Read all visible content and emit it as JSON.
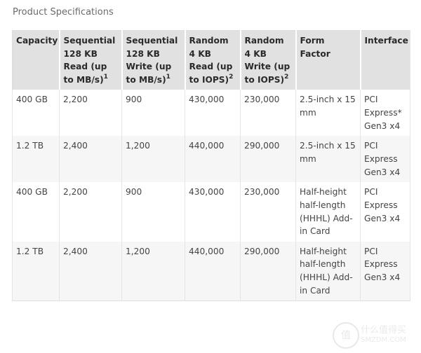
{
  "page": {
    "title": "Product Specifications"
  },
  "table": {
    "headers": [
      {
        "label": "Capacity",
        "sup": ""
      },
      {
        "label": "Sequential 128 KB Read (up to MB/s)",
        "sup": "1"
      },
      {
        "label": "Sequential 128 KB Write (up to MB/s)",
        "sup": "1"
      },
      {
        "label": "Random 4 KB Read (up to IOPS)",
        "sup": "2"
      },
      {
        "label": "Random 4 KB Write (up to IOPS)",
        "sup": "2"
      },
      {
        "label": "Form Factor",
        "sup": ""
      },
      {
        "label": "Interface",
        "sup": ""
      }
    ],
    "rows": [
      [
        "400 GB",
        "2,200",
        "900",
        "430,000",
        "230,000",
        "2.5-inch x 15 mm",
        "PCI Express* Gen3 x4"
      ],
      [
        "1.2 TB",
        "2,400",
        "1,200",
        "440,000",
        "290,000",
        "2.5-inch x 15 mm",
        "PCI Express Gen3 x4"
      ],
      [
        "400 GB",
        "2,200",
        "900",
        "430,000",
        "230,000",
        "Half-height half-length (HHHL) Add-in Card",
        "PCI Express Gen3 x4"
      ],
      [
        "1.2 TB",
        "2,400",
        "1,200",
        "440,000",
        "290,000",
        "Half-height half-length (HHHL) Add-in Card",
        "PCI Express Gen3 x4"
      ]
    ]
  },
  "watermark": {
    "logo_char": "值",
    "text": "什么值得买",
    "subtext": "SMZDM.COM"
  }
}
